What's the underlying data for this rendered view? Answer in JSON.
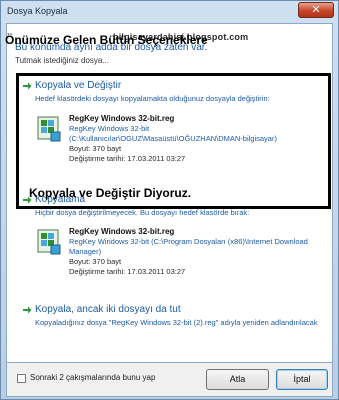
{
  "window": {
    "title": "Dosya Kopyala",
    "close_glyph": "✕"
  },
  "watermark": "bilgisayardahisi.blogspot.com",
  "instruction": {
    "main": "Bu konumda aynı adda bir dosya zaten var.",
    "sub": "Tutmak istediğiniz dosya..."
  },
  "annotations": {
    "top": "Önümüze Gelen Bütün Seçeneklere",
    "bottom": "Kopyala ve Değiştir Diyoruz."
  },
  "options": [
    {
      "title": "Kopyala ve Değiştir",
      "desc": "Hedef klasördeki dosyayı kopyalamakta olduğunuz dosyayla değiştirin:",
      "file_name": "RegKey Windows 32-bit.reg",
      "file_path": "RegKey Windows 32-bit (C:\\Kullanıcılar\\OGUZ\\Masaüstü\\OĞUZHAN\\DMAN-bilgisayar)",
      "size": "Boyut: 370 bayt",
      "date": "Değiştirme tarihi: 17.03.2011 03:27"
    },
    {
      "title": "Kopyalama",
      "desc": "Hiçbir dosya değiştirilmeyecek. Bu dosyayı hedef klasörde bırak:",
      "file_name": "RegKey Windows 32-bit.reg",
      "file_path": "RegKey Windows 32-bit (C:\\Program Dosyaları (x86)\\Internet Download Manager)",
      "size": "Boyut: 370 bayt",
      "date": "Değiştirme tarihi: 17.03.2011 03:27"
    },
    {
      "title": "Kopyala, ancak iki dosyayı da tut",
      "desc": "Kopyaladığınız dosya \"RegKey Windows 32-bit (2).reg\" adıyla yeniden adlandırılacak"
    }
  ],
  "footer": {
    "checkbox_label": "Sonraki 2 çakışmalarında bunu yap",
    "skip_label": "Atla",
    "cancel_label": "İptal"
  },
  "colors": {
    "link_blue": "#1e5ba8",
    "arrow_green": "#2f9a3a",
    "titlebar": "#b9cfe6"
  },
  "icons": [
    "close-icon",
    "green-arrow-icon",
    "reg-file-icon"
  ]
}
